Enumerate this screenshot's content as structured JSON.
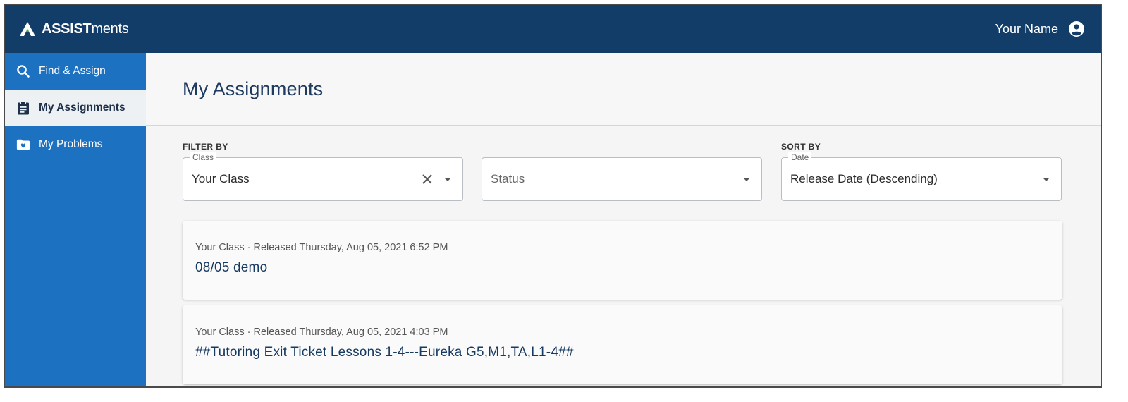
{
  "app": {
    "brand_strong": "ASSIST",
    "brand_light": "ments",
    "user_name": "Your Name"
  },
  "sidebar": {
    "items": [
      {
        "label": "Find & Assign",
        "icon": "search-icon",
        "active": false
      },
      {
        "label": "My Assignments",
        "icon": "clipboard-icon",
        "active": true
      },
      {
        "label": "My Problems",
        "icon": "folder-heart-icon",
        "active": false
      }
    ]
  },
  "main": {
    "title": "My Assignments",
    "filter_label": "FILTER BY",
    "sort_label": "SORT BY",
    "class_select": {
      "legend": "Class",
      "value": "Your Class"
    },
    "status_select": {
      "placeholder": "Status"
    },
    "date_select": {
      "legend": "Date",
      "value": "Release Date (Descending)"
    },
    "assignments": [
      {
        "meta": "Your Class · Released Thursday, Aug 05, 2021 6:52 PM",
        "title": "08/05 demo"
      },
      {
        "meta": "Your Class · Released Thursday, Aug 05, 2021 4:03 PM",
        "title": "##Tutoring Exit Ticket Lessons 1-4---Eureka G5,M1,TA,L1-4##"
      }
    ]
  },
  "colors": {
    "topbar": "#133d69",
    "sidebar": "#1c71c1",
    "active_item": "#eef1f4",
    "title_text": "#1e3a5f"
  }
}
